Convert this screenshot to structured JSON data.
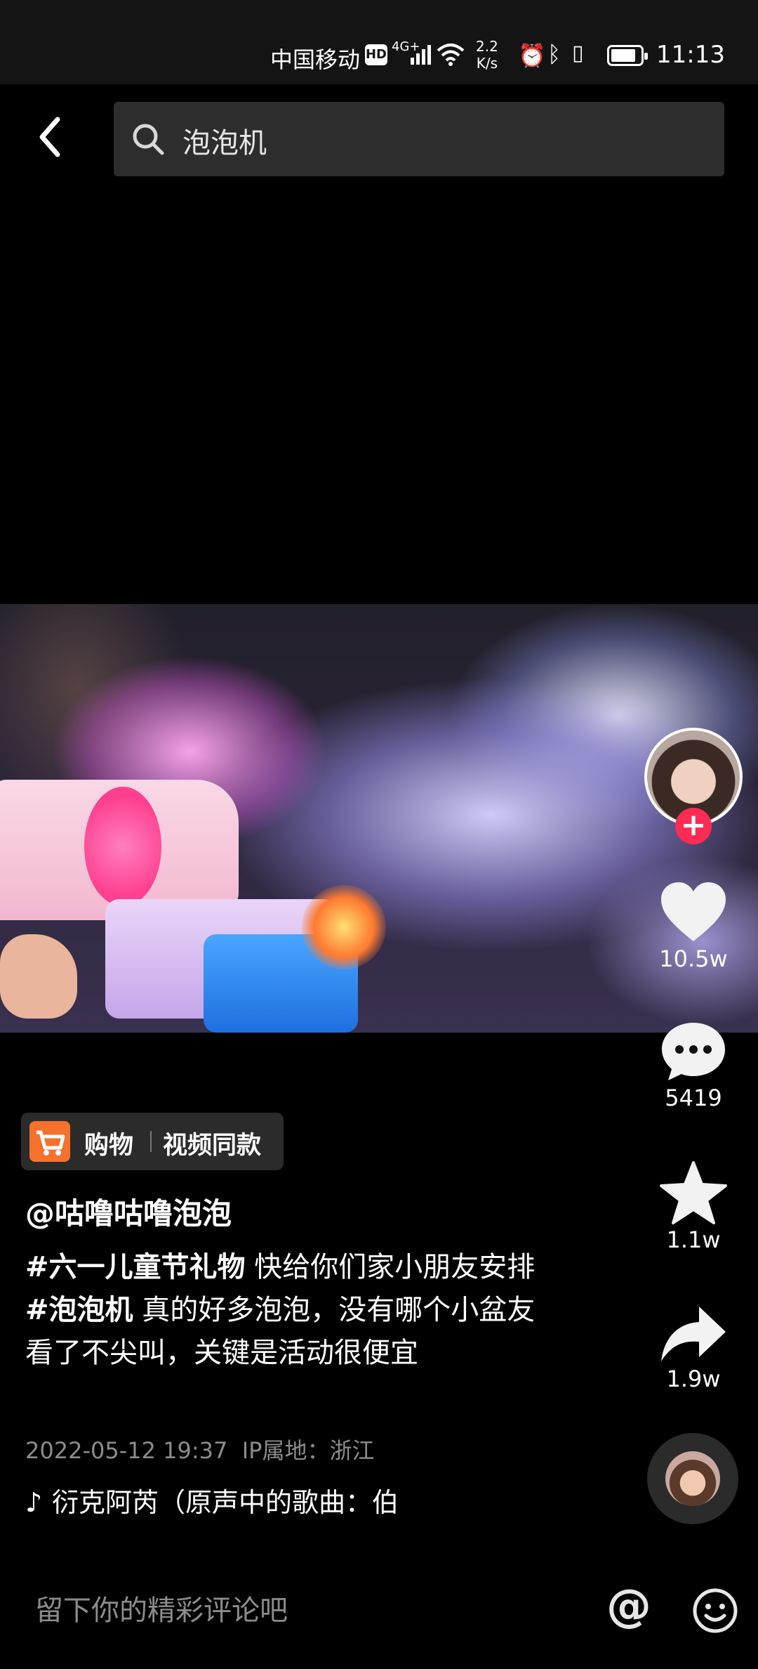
{
  "status_bar": {
    "carrier": "中国移动",
    "hd": "HD",
    "network": "4G+",
    "speed_value": "2.2",
    "speed_unit": "K/s",
    "time": "11:13",
    "battery_level": 0.85
  },
  "search": {
    "query": "泡泡机"
  },
  "actions": {
    "likes": "10.5w",
    "comments": "5419",
    "favorites": "1.1w",
    "shares": "1.9w"
  },
  "shop": {
    "label": "购物",
    "same_style": "视频同款"
  },
  "post": {
    "author": "@咕噜咕噜泡泡",
    "tag1": "#六一儿童节礼物",
    "text1": " 快给你们家小朋友安排",
    "tag2": "#泡泡机",
    "text2": " 真的好多泡泡，没有哪个小盆友看了不尖叫，关键是活动很便宜",
    "date": "2022-05-12 19:37",
    "ip_location": "IP属地：浙江",
    "music": "衍克阿芮（原声中的歌曲：伯"
  },
  "comment_bar": {
    "placeholder": "留下你的精彩评论吧",
    "at_symbol": "@"
  },
  "colors": {
    "accent": "#fe2c55",
    "shop_orange": "#f6712c"
  }
}
